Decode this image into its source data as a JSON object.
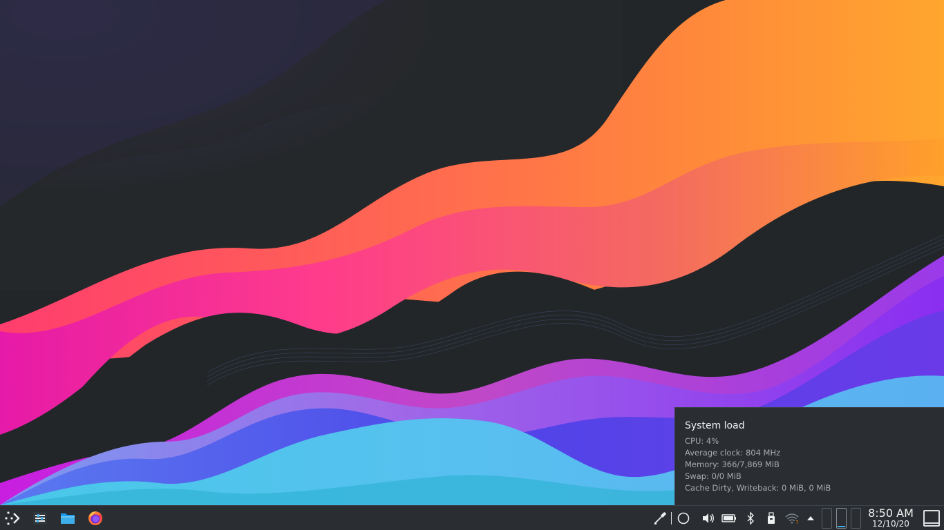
{
  "tooltip": {
    "title": "System load",
    "lines": [
      "CPU: 4%",
      "Average clock: 804 MHz",
      "Memory: 366/7,869 MiB",
      "Swap: 0/0 MiB",
      "Cache Dirty, Writeback: 0 MiB, 0 MiB"
    ]
  },
  "taskbar": {
    "launchers": [
      {
        "icon": "application-launcher-icon"
      },
      {
        "icon": "system-settings-icon"
      },
      {
        "icon": "file-manager-icon"
      },
      {
        "icon": "firefox-icon"
      }
    ],
    "tray": [
      {
        "icon": "color-picker-icon"
      },
      {
        "icon": "system-load-icon"
      },
      {
        "icon": "volume-icon"
      },
      {
        "icon": "battery-icon"
      },
      {
        "icon": "bluetooth-icon"
      },
      {
        "icon": "usb-device-icon"
      },
      {
        "icon": "network-wifi-icon"
      },
      {
        "icon": "expand-tray-icon"
      }
    ],
    "pager": {
      "desktops": 3,
      "active": 2
    },
    "clock": {
      "time": "8:50 AM",
      "date": "12/10/20"
    }
  },
  "colors": {
    "panel": "#2a2e32",
    "text": "#eff0f1",
    "accent": "#3daee9"
  }
}
